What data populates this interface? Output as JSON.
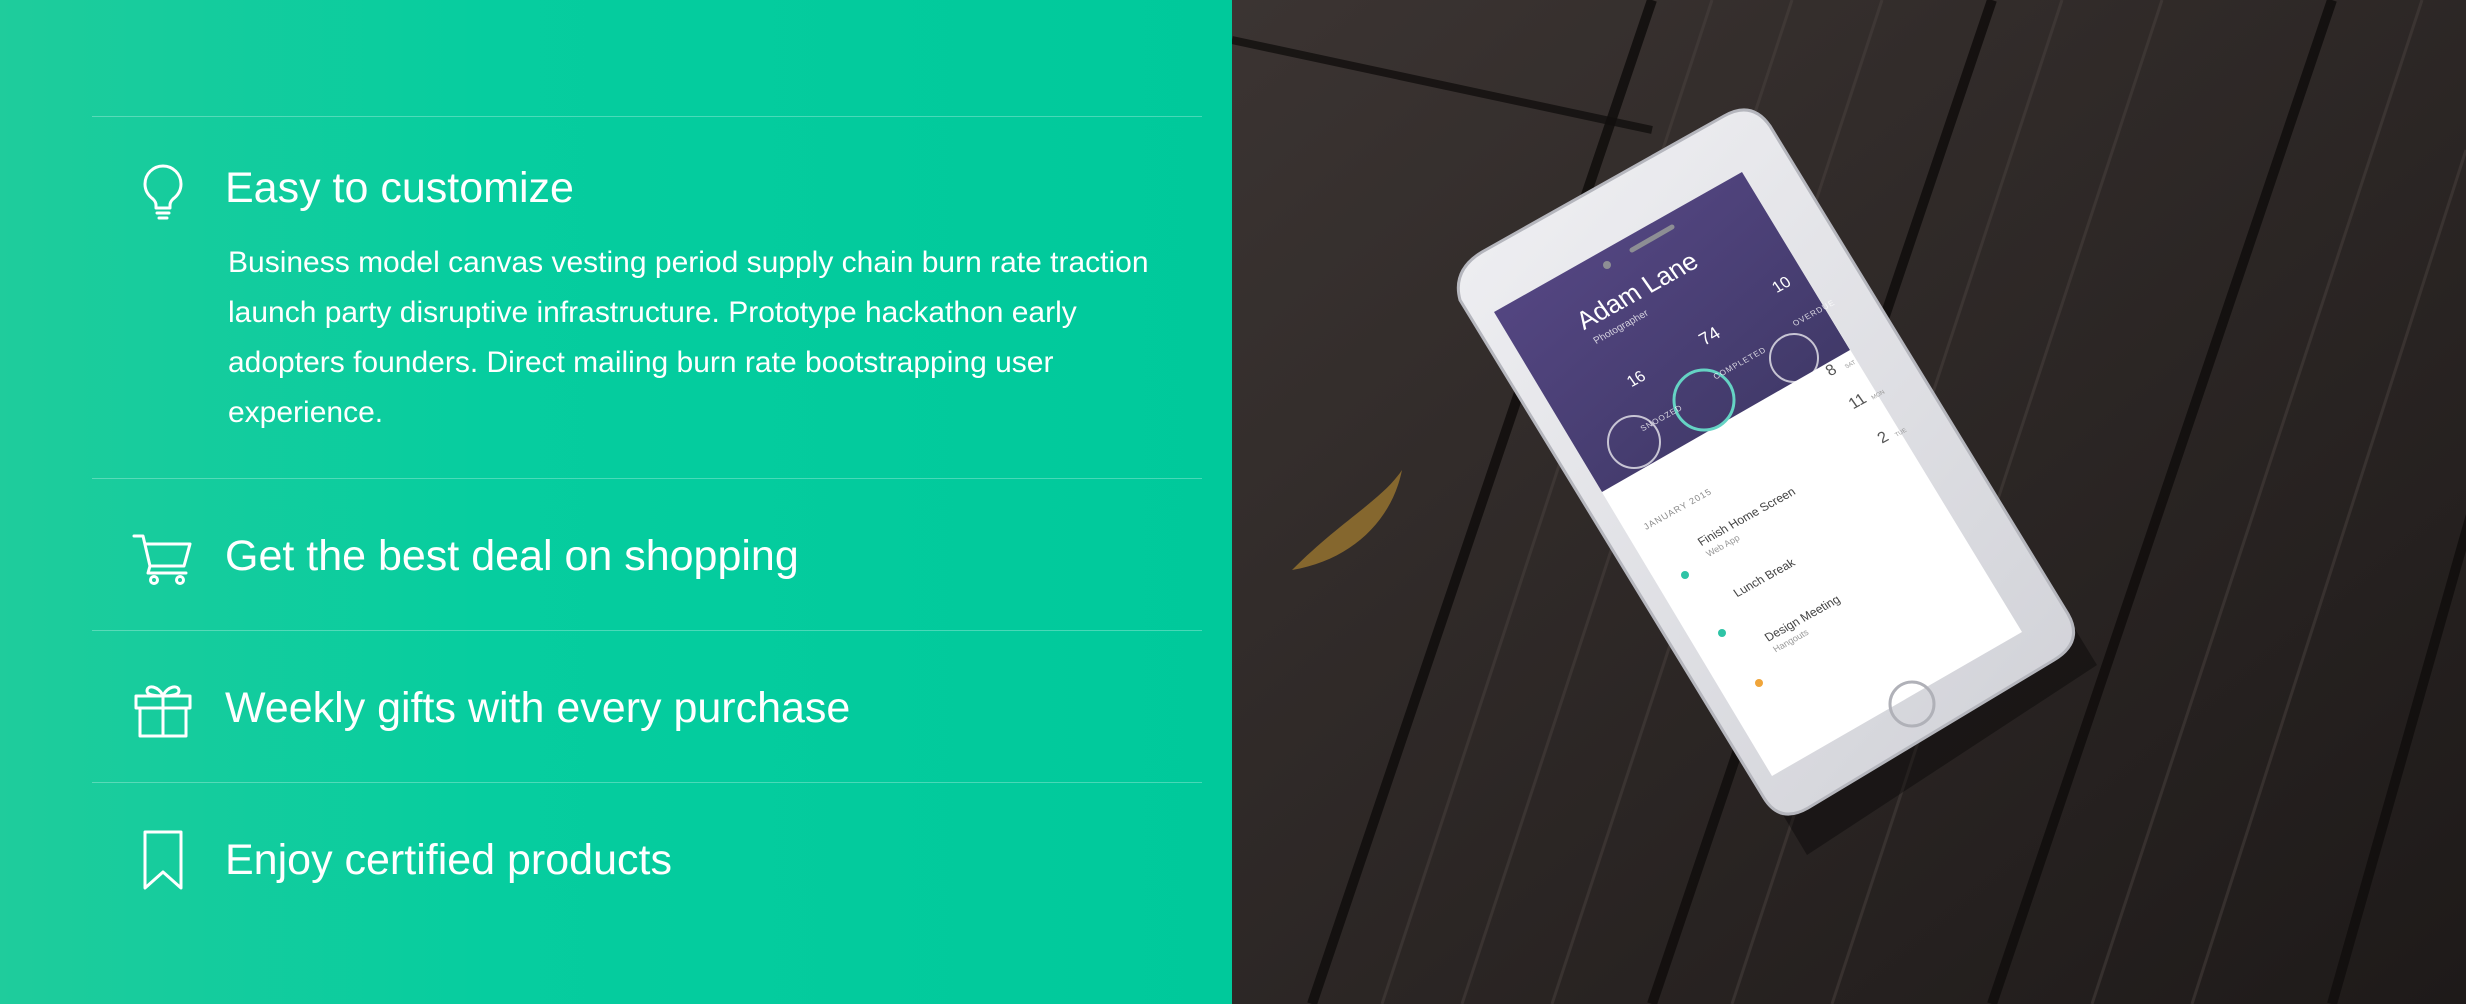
{
  "features": [
    {
      "icon": "lightbulb-icon",
      "title": "Easy to customize",
      "description": "Business model canvas vesting period supply chain burn rate traction launch party disruptive infrastructure. Prototype hackathon early adopters founders. Direct mailing burn rate bootstrapping user experience."
    },
    {
      "icon": "shopping-cart-icon",
      "title": "Get the best deal on shopping"
    },
    {
      "icon": "gift-icon",
      "title": "Weekly gifts with every purchase"
    },
    {
      "icon": "bookmark-icon",
      "title": "Enjoy certified products"
    }
  ],
  "phone": {
    "user_name": "Adam Lane",
    "user_role": "Photographer",
    "stats": [
      {
        "value": "16",
        "label": "SNOOZED"
      },
      {
        "value": "74",
        "label": "COMPLETED"
      },
      {
        "value": "10",
        "label": "OVERDUE"
      }
    ],
    "month": "JANUARY 2015",
    "tasks": [
      {
        "title": "Finish Home Screen",
        "subtitle": "Web App"
      },
      {
        "title": "Lunch Break",
        "subtitle": ""
      },
      {
        "title": "Design Meeting",
        "subtitle": "Hangouts"
      }
    ],
    "dates": [
      {
        "day": "8",
        "dow": "SAT"
      },
      {
        "day": "11",
        "dow": "MON"
      },
      {
        "day": "2",
        "dow": "TUE"
      }
    ]
  },
  "colors": {
    "panel_green": "#00c99b",
    "text": "#ffffff",
    "phone_header": "#4a3e73",
    "wood": "#2a2523"
  }
}
